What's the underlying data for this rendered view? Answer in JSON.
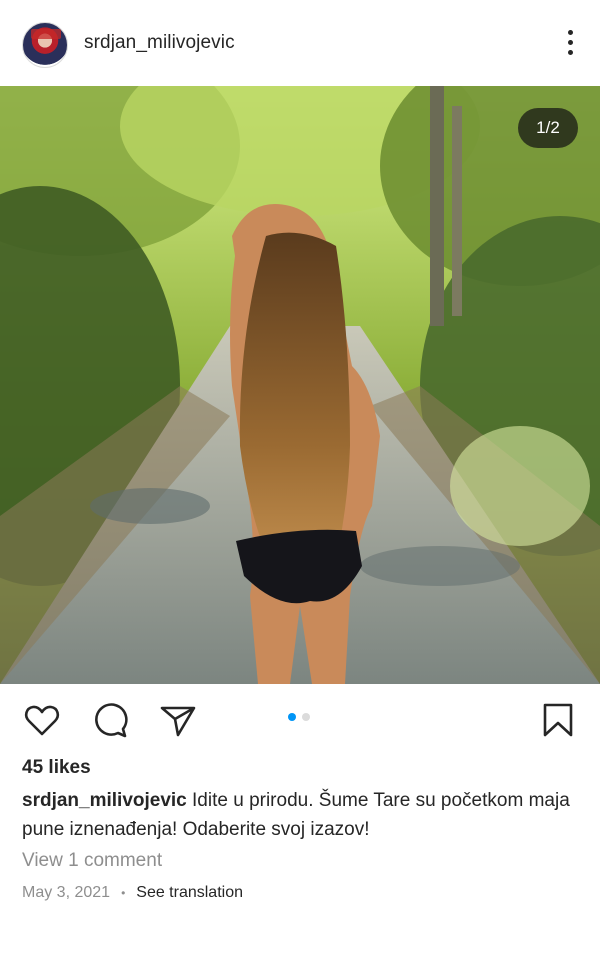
{
  "post": {
    "username": "srdjan_milivojevic",
    "image_counter": "1/2",
    "carousel": {
      "total": 2,
      "active_index": 0
    },
    "likes": "45 likes",
    "caption_text": "Idite u prirodu. Šume Tare su početkom maja pune iznenađenja! Odaberite svoj izazov!",
    "view_comments": "View 1 comment",
    "date": "May 3, 2021",
    "separator": "•",
    "see_translation": "See translation"
  },
  "icons": {
    "more": "more-vertical-icon",
    "like": "heart-icon",
    "comment": "comment-bubble-icon",
    "share": "paper-plane-icon",
    "save": "bookmark-icon"
  },
  "colors": {
    "text": "#262626",
    "muted": "#8e8e8e",
    "accent_dot": "#0095f6",
    "inactive_dot": "#dbdbdb"
  }
}
